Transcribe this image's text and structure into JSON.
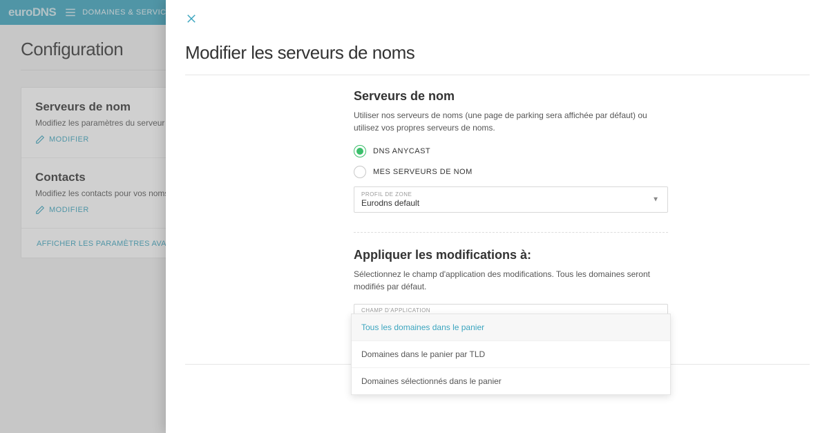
{
  "topbar": {
    "logo": "euroDNS",
    "link": "DOMAINES & SERVICES"
  },
  "page": {
    "title": "Configuration",
    "advanced": "AFFICHER LES PARAMÈTRES AVANCÉS"
  },
  "cards": {
    "ns": {
      "title": "Serveurs de nom",
      "desc": "Modifiez les paramètres du serveur de noms pour",
      "action": "MODIFIER"
    },
    "contacts": {
      "title": "Contacts",
      "desc": "Modifiez les contacts pour vos noms de domaine",
      "action": "MODIFIER"
    }
  },
  "panel": {
    "title": "Modifier les serveurs de noms",
    "ns": {
      "title": "Serveurs de nom",
      "desc": "Utiliser nos serveurs de noms (une page de parking sera affichée par défaut) ou utilisez vos propres serveurs de noms.",
      "opt_anycast": "DNS ANYCAST",
      "opt_own": "MES SERVEURS DE NOM",
      "profile_label": "PROFIL DE ZONE",
      "profile_value": "Eurodns default"
    },
    "apply": {
      "title": "Appliquer les modifications à:",
      "desc": "Sélectionnez le champ d'application des modifications. Tous les domaines seront modifiés par défaut.",
      "scope_label": "CHAMP D'APPLICATION",
      "options": [
        "Tous les domaines dans le panier",
        "Domaines dans le panier par TLD",
        "Domaines sélectionnés dans le panier"
      ]
    }
  }
}
